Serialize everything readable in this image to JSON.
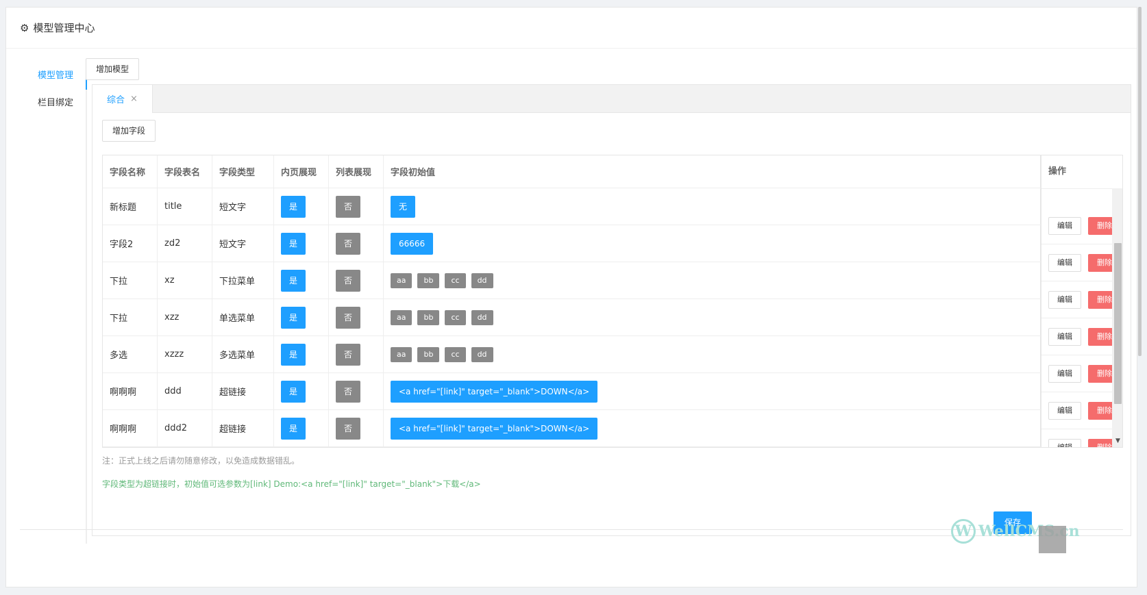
{
  "header": {
    "icon": "gear-icon",
    "title": "模型管理中心"
  },
  "sidebar": {
    "items": [
      {
        "label": "模型管理",
        "active": true
      },
      {
        "label": "栏目绑定",
        "active": false
      }
    ]
  },
  "toolbar": {
    "add_model": "增加模型",
    "add_field": "增加字段"
  },
  "tabs": [
    {
      "label": "综合",
      "close": "×"
    }
  ],
  "table": {
    "columns": [
      "字段名称",
      "字段表名",
      "字段类型",
      "内页展现",
      "列表展现",
      "字段初始值"
    ],
    "ops_header": "操作",
    "rows": [
      {
        "name": "新标题",
        "table": "title",
        "type": "短文字",
        "inner": "是",
        "list": "否",
        "defaults": [
          "无"
        ]
      },
      {
        "name": "字段2",
        "table": "zd2",
        "type": "短文字",
        "inner": "是",
        "list": "否",
        "defaults": [
          "66666"
        ]
      },
      {
        "name": "下拉",
        "table": "xz",
        "type": "下拉菜单",
        "inner": "是",
        "list": "否",
        "defaults": [
          "aa",
          "bb",
          "cc",
          "dd"
        ]
      },
      {
        "name": "下拉",
        "table": "xzz",
        "type": "单选菜单",
        "inner": "是",
        "list": "否",
        "defaults": [
          "aa",
          "bb",
          "cc",
          "dd"
        ]
      },
      {
        "name": "多选",
        "table": "xzzz",
        "type": "多选菜单",
        "inner": "是",
        "list": "否",
        "defaults": [
          "aa",
          "bb",
          "cc",
          "dd"
        ]
      },
      {
        "name": "啊啊啊",
        "table": "ddd",
        "type": "超链接",
        "inner": "是",
        "list": "否",
        "defaults": [
          "<a href=\"[link]\" target=\"_blank\">DOWN</a>"
        ]
      },
      {
        "name": "啊啊啊",
        "table": "ddd2",
        "type": "超链接",
        "inner": "是",
        "list": "否",
        "defaults": [
          "<a href=\"[link]\" target=\"_blank\">DOWN</a>"
        ]
      }
    ],
    "ops": {
      "edit": "编辑",
      "delete": "删除"
    }
  },
  "notes": {
    "warning": "注：正式上线之后请勿随意修改，以免造成数据错乱。",
    "hint": "字段类型为超链接时，初始值可选参数为[link] Demo:<a href=\"[link]\" target=\"_blank\">下载</a>"
  },
  "footer": {
    "save": "保存"
  },
  "watermark": {
    "text": "WellCMS.cn",
    "logo": "W"
  },
  "colors": {
    "primary": "#1e9fff",
    "gray_tag": "#888888",
    "danger": "#f56c6c",
    "hint_green": "#5fb878"
  }
}
